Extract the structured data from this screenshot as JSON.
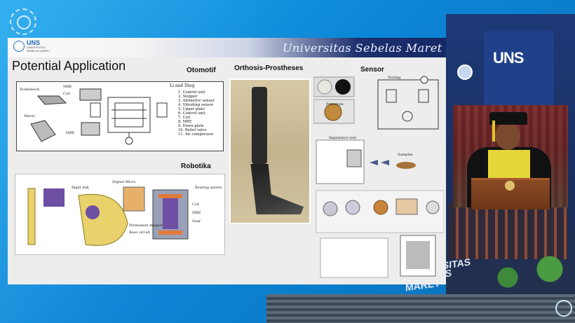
{
  "background": {
    "sign_lines": [
      "UNIVERSITAS",
      "SEBELAS",
      "MARET"
    ],
    "building_logo": "UNS"
  },
  "slide": {
    "header": {
      "logo_name": "UNS",
      "logo_sub": [
        "UNIVERSITAS",
        "SEBELAS MARET"
      ],
      "university_name": "Universitas Sebelas Maret"
    },
    "title": "Potential Application",
    "sections": {
      "otomotif": "Otomotif",
      "orthosis": "Orthosis-Prostheses",
      "sensor": "Sensor",
      "robotika": "Robotika"
    },
    "otomotif_diagram": {
      "labels": [
        "Rodenbeck",
        "MRE",
        "Coil",
        "Marur",
        "MRE"
      ],
      "li_dong": "Li and Ding",
      "parts": [
        "1.  Control unit",
        "2.  Stopper",
        "3.  Altimetric sensor",
        "4.  Vibrating sensor",
        "5.  Upper plate",
        "6.  Control unit",
        "7.  Coil",
        "8.  MRE",
        "9.  Down plate",
        "10. Relief valve",
        "11. Air compressor"
      ]
    },
    "sensor_diagram": {
      "labels": [
        "Prototype",
        "Testing",
        "Impedance test",
        "Samples"
      ]
    },
    "robotika_diagram": {
      "labels": [
        "Right link",
        "Digital Micro",
        "Bearing assists",
        "Coil",
        "MRE",
        "Gear",
        "Permanent magnet",
        "Base circuit"
      ]
    }
  },
  "colors": {
    "slide_bg": "#ededed",
    "header_dark": "#172965",
    "page_blue": "#0f8fd8"
  },
  "icons": [
    "uns-seal-icon",
    "uns-seal-icon-corner"
  ]
}
